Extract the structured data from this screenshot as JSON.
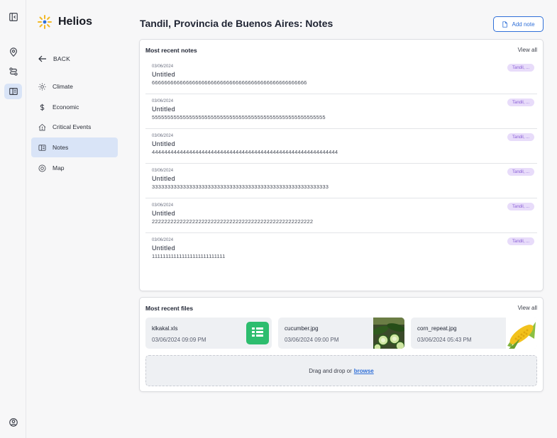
{
  "app": {
    "name": "Helios"
  },
  "sidebar": {
    "back_label": "BACK",
    "items": [
      {
        "label": "Climate",
        "icon": "sun-icon"
      },
      {
        "label": "Economic",
        "icon": "dollar-icon"
      },
      {
        "label": "Critical Events",
        "icon": "house-alert-icon"
      },
      {
        "label": "Notes",
        "icon": "notes-icon",
        "active": true
      },
      {
        "label": "Map",
        "icon": "map-pin-icon"
      }
    ]
  },
  "header": {
    "title": "Tandil, Provincia de Buenos Aires: Notes",
    "add_note_label": "Add note"
  },
  "notes_section": {
    "title": "Most recent notes",
    "view_all": "View all",
    "notes": [
      {
        "date": "03/06/2024",
        "title": "Untitled",
        "body": "66666666666666666666666666666666666666666666666666",
        "tag": "Tandil, ..."
      },
      {
        "date": "03/06/2024",
        "title": "Untitled",
        "body": "55555555555555555555555555555555555555555555555555555555",
        "tag": "Tandil, ..."
      },
      {
        "date": "03/06/2024",
        "title": "Untitled",
        "body": "444444444444444444444444444444444444444444444444444444444444",
        "tag": "Tandil, ..."
      },
      {
        "date": "03/06/2024",
        "title": "Untitled",
        "body": "333333333333333333333333333333333333333333333333333333333",
        "tag": "Tandil, ..."
      },
      {
        "date": "03/06/2024",
        "title": "Untitled",
        "body": "2222222222222222222222222222222222222222222222222222",
        "tag": "Tandil, ..."
      },
      {
        "date": "03/06/2024",
        "title": "Untitled",
        "body": "111111111111111111111111111",
        "tag": "Tandil, ..."
      }
    ]
  },
  "files_section": {
    "title": "Most recent files",
    "view_all": "View all",
    "files": [
      {
        "name": "klkakal.xls",
        "date": "03/06/2024 09:09 PM",
        "thumb": "spreadsheet-icon"
      },
      {
        "name": "cucumber.jpg",
        "date": "03/06/2024 09:00 PM",
        "thumb": "cucumber-image"
      },
      {
        "name": "corn_repeat.jpg",
        "date": "03/06/2024 05:43 PM",
        "thumb": "corn-image"
      }
    ],
    "drop_text": "Drag and drop or",
    "browse_label": "browse"
  },
  "colors": {
    "accent": "#2f6fd8",
    "active_nav": "#d9e4f7",
    "tag_bg": "#e8dcfa",
    "tag_text": "#8a5fd6",
    "xls_green": "#2dbd6e"
  }
}
